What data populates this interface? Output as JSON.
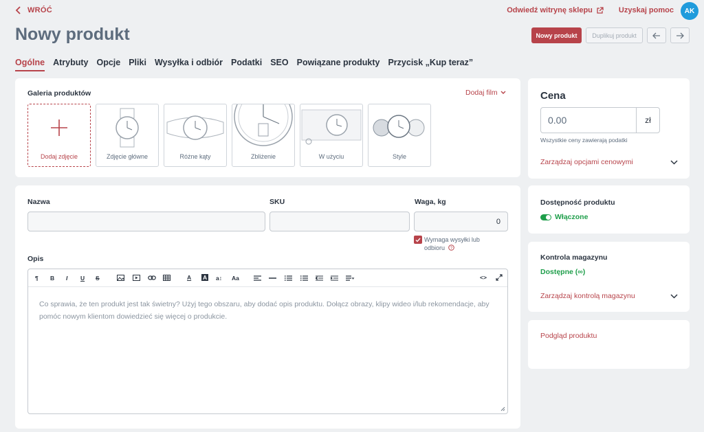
{
  "header": {
    "back_label": "WRÓĆ",
    "title": "Nowy produkt",
    "visit_store": "Odwiedź witrynę sklepu",
    "get_help": "Uzyskaj pomoc",
    "avatar_initials": "AK",
    "new_product_button": "Nowy produkt",
    "duplicate_button": "Duplikuj produkt"
  },
  "tabs": [
    "Ogólne",
    "Atrybuty",
    "Opcje",
    "Pliki",
    "Wysyłka i odbiór",
    "Podatki",
    "SEO",
    "Powiązane produkty",
    "Przycisk „Kup teraz”"
  ],
  "gallery": {
    "title": "Galeria produktów",
    "add_video": "Dodaj film",
    "add_photo": "Dodaj zdjęcie",
    "thumbs": [
      "Zdjęcie główne",
      "Różne kąty",
      "Zbliżenie",
      "W użyciu",
      "Style"
    ]
  },
  "form": {
    "name_label": "Nazwa",
    "sku_label": "SKU",
    "weight_label": "Waga, kg",
    "weight_value": "0",
    "shipping_checkbox": "Wymaga wysyłki lub odbioru",
    "desc_label": "Opis",
    "desc_placeholder": "Co sprawia, że ten produkt jest tak świetny? Użyj tego obszaru, aby dodać opis produktu. Dołącz obrazy, klipy wideo i/lub rekomendacje, aby pomóc nowym klientom dowiedzieć się więcej o produkcie."
  },
  "price": {
    "title": "Cena",
    "value": "0.00",
    "currency": "zł",
    "note": "Wszystkie ceny zawierają podatki",
    "manage_options": "Zarządzaj opcjami cenowymi"
  },
  "availability": {
    "title": "Dostępność produktu",
    "status": "Włączone"
  },
  "inventory": {
    "title": "Kontrola magazynu",
    "status": "Dostępne (∞)",
    "manage": "Zarządzaj kontrolą magazynu"
  },
  "preview": {
    "label": "Podgląd produktu"
  },
  "colors": {
    "accent": "#b7434a",
    "success": "#1e9e4a",
    "avatar": "#1f9bdc"
  }
}
